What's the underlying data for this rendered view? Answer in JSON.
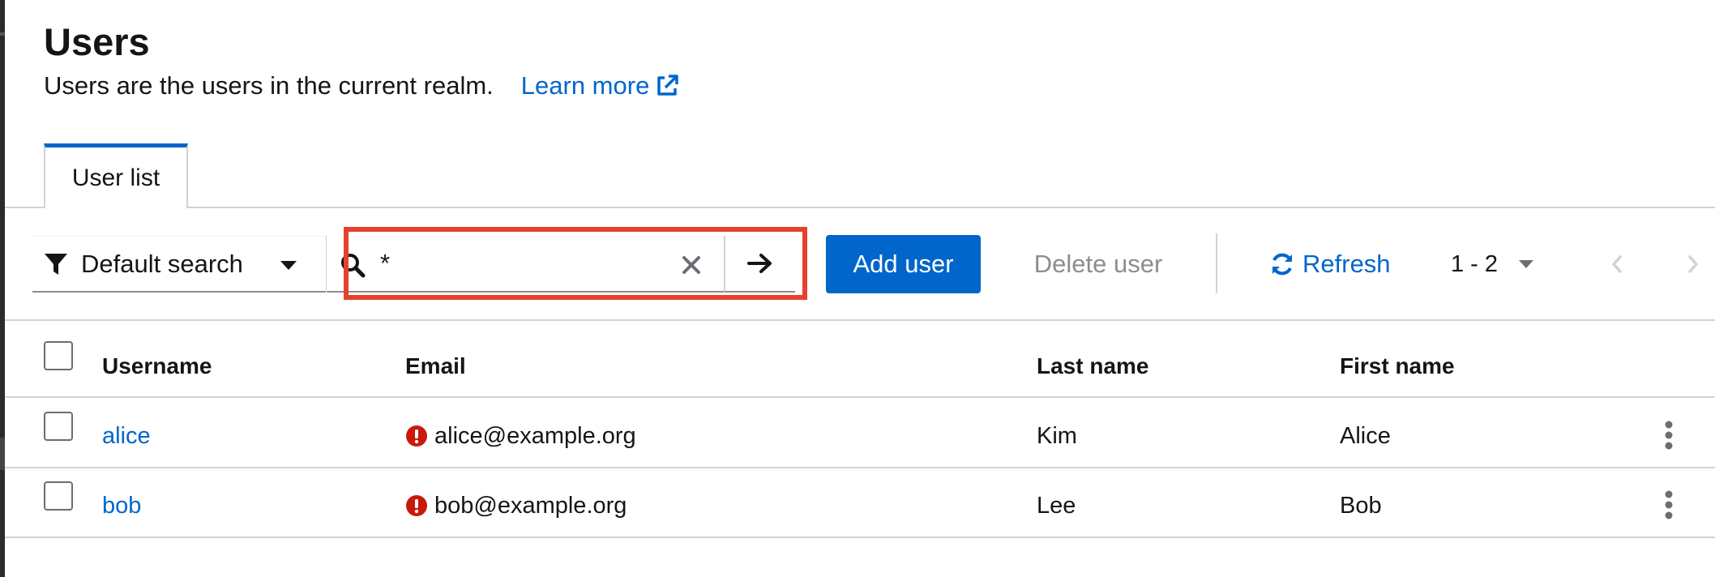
{
  "header": {
    "title": "Users",
    "description": "Users are the users in the current realm.",
    "learn_more": "Learn more"
  },
  "tabs": [
    {
      "label": "User list",
      "active": true
    }
  ],
  "toolbar": {
    "filter_label": "Default search",
    "search_value": "*",
    "add_user_label": "Add user",
    "delete_user_label": "Delete user",
    "refresh_label": "Refresh",
    "pagination_range": "1 - 2"
  },
  "table": {
    "columns": [
      "Username",
      "Email",
      "Last name",
      "First name"
    ],
    "rows": [
      {
        "username": "alice",
        "email": "alice@example.org",
        "last_name": "Kim",
        "first_name": "Alice",
        "email_unverified": true
      },
      {
        "username": "bob",
        "email": "bob@example.org",
        "last_name": "Lee",
        "first_name": "Bob",
        "email_unverified": true
      }
    ]
  },
  "colors": {
    "accent": "#0066cc",
    "highlight": "#e5412d",
    "warning": "#c9190b",
    "disabled_text": "#8a8d90"
  },
  "icons": {
    "external_link": "external-link-icon",
    "filter": "filter-icon",
    "search": "search-icon",
    "clear": "close-icon",
    "submit": "arrow-right-icon",
    "refresh": "sync-icon",
    "warning": "exclamation-circle-icon",
    "row_actions": "kebab-icon"
  }
}
